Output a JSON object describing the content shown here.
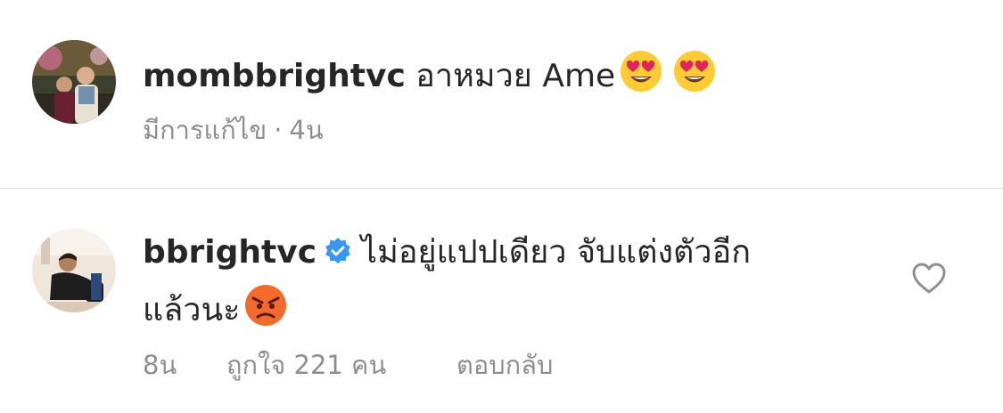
{
  "comment1": {
    "username": "mombbrightvc",
    "text": "อาหมวย Ame",
    "emojis": [
      "heart-eyes-emoji",
      "heart-eyes-emoji"
    ],
    "edited_label": "มีการแก้ไข",
    "separator": "·",
    "time": "4น"
  },
  "comment2": {
    "username": "bbrightvc",
    "verified": true,
    "text_line1": "ไม่อยู่แปปเดียว จับแต่งตัวอีก",
    "text_line2": "แล้วนะ",
    "emojis": [
      "angry-face-emoji"
    ],
    "time": "8น",
    "likes": "ถูกใจ 221 คน",
    "reply_label": "ตอบกลับ"
  },
  "colors": {
    "text": "#262626",
    "secondary": "#8e8e8e",
    "divider": "#dbdbdb",
    "verified_blue": "#3897f0",
    "emoji_yellow": "#ffcc33",
    "heart_red": "#e0245e",
    "angry_orange": "#f26a2c"
  }
}
